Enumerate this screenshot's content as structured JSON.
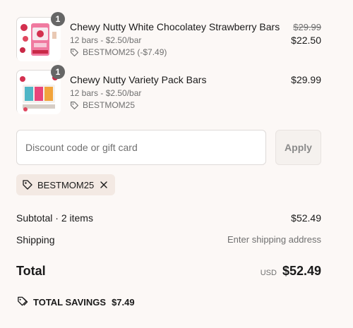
{
  "line_items": [
    {
      "quantity": "1",
      "title": "Chewy Nutty White Chocolatey Strawberry Bars",
      "subtitle": "12 bars - $2.50/bar",
      "discount": "BESTMOM25 (-$7.49)",
      "compare_price": "$29.99",
      "price": "$22.50",
      "image": "strawberry-bars-bag-thumbnail"
    },
    {
      "quantity": "1",
      "title": "Chewy Nutty Variety Pack Bars",
      "subtitle": "12 bars - $2.50/bar",
      "discount": "BESTMOM25",
      "price": "$29.99",
      "image": "variety-pack-box-thumbnail"
    }
  ],
  "discount_form": {
    "placeholder": "Discount code or gift card",
    "value": "",
    "apply_label": "Apply"
  },
  "applied_code": {
    "label": "BESTMOM25",
    "icons": [
      "tag-icon",
      "close-icon"
    ]
  },
  "summary": {
    "subtotal_label": "Subtotal · 2 items",
    "subtotal_value": "$52.49",
    "shipping_label": "Shipping",
    "shipping_value": "Enter shipping address",
    "total_label": "Total",
    "currency": "USD",
    "total_value": "$52.49",
    "savings_label": "TOTAL SAVINGS",
    "savings_value": "$7.49"
  },
  "colors": {
    "background": "#fcf8f6",
    "badge": "#666666",
    "chip": "#f3e9e3",
    "muted_text": "#707070",
    "brand_pink": "#e8457a"
  }
}
